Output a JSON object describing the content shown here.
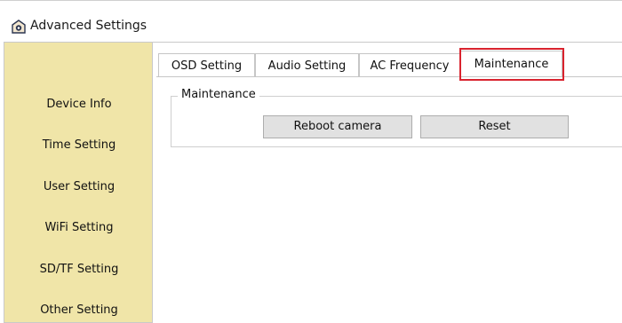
{
  "window": {
    "title": "Advanced Settings",
    "icon": "camera-app-icon"
  },
  "sidebar": {
    "items": [
      {
        "label": "Device Info"
      },
      {
        "label": "Time Setting"
      },
      {
        "label": "User Setting"
      },
      {
        "label": "WiFi Setting"
      },
      {
        "label": "SD/TF Setting"
      },
      {
        "label": "Other Setting"
      }
    ],
    "background": "#f0e5a8"
  },
  "tabs": [
    {
      "label": "OSD Setting"
    },
    {
      "label": "Audio Setting"
    },
    {
      "label": "AC Frequency"
    },
    {
      "label": "Maintenance",
      "selected": true
    }
  ],
  "highlight_color": "#d9232e",
  "maintenance": {
    "group_label": "Maintenance",
    "reboot_label": "Reboot camera",
    "reset_label": "Reset"
  }
}
